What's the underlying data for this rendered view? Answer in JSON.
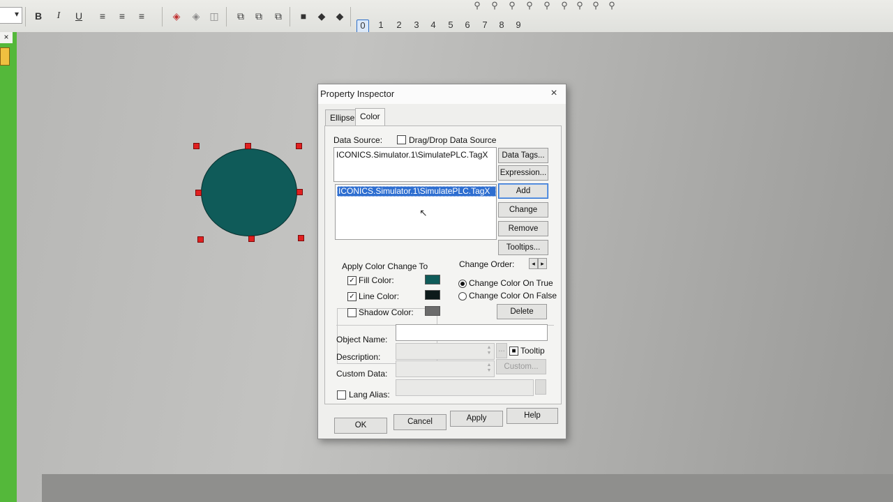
{
  "toolbar": {
    "format_buttons": {
      "bold": "B",
      "italic": "I",
      "underline": "U"
    },
    "level_buttons": [
      "0",
      "1",
      "2",
      "3",
      "4",
      "5",
      "6",
      "7",
      "8",
      "9"
    ],
    "selected_level": "0"
  },
  "left_panel": {
    "close_label": "×"
  },
  "dialog": {
    "title": "Property Inspector",
    "close_label": "×",
    "tabs": [
      {
        "label": "Ellipse",
        "selected": false
      },
      {
        "label": "Color",
        "selected": true
      }
    ],
    "data_source": {
      "label": "Data Source:",
      "drag_drop_label": "Drag/Drop Data Source",
      "drag_drop_checked": false,
      "expression_value": "ICONICS.Simulator.1\\SimulatePLC.TagX",
      "list_items": [
        {
          "text": "ICONICS.Simulator.1\\SimulatePLC.TagX",
          "selected": true
        }
      ]
    },
    "side_buttons": {
      "data_tags": "Data Tags...",
      "expression": "Expression...",
      "add": "Add",
      "change": "Change",
      "remove": "Remove",
      "tooltips": "Tooltips..."
    },
    "apply_color_change": {
      "group_label": "Apply Color Change To",
      "items": [
        {
          "label": "Fill Color:",
          "checked": true,
          "color": "#0f5b59"
        },
        {
          "label": "Line Color:",
          "checked": true,
          "color": "#0d1a1a"
        },
        {
          "label": "Shadow Color:",
          "checked": false,
          "color": "#6b6b6b"
        }
      ]
    },
    "change_order": {
      "label": "Change Order:",
      "left_arrow": "◂",
      "right_arrow": "▸",
      "options": [
        {
          "label": "Change Color On True",
          "selected": true
        },
        {
          "label": "Change Color On False",
          "selected": false
        }
      ],
      "delete_label": "Delete"
    },
    "object_name": {
      "label": "Object Name:",
      "value": ""
    },
    "description": {
      "label": "Description:",
      "value": "",
      "browse_label": "..."
    },
    "tooltip": {
      "label": "Tooltip",
      "checked": true
    },
    "custom_data": {
      "label": "Custom Data:",
      "value": "",
      "button_label": "Custom..."
    },
    "lang_alias": {
      "label": "Lang Alias:",
      "checked": false,
      "value": ""
    },
    "footer_buttons": {
      "ok": "OK",
      "cancel": "Cancel",
      "apply": "Apply",
      "help": "Help"
    }
  },
  "colors": {
    "ellipse_fill": "#0f5b59",
    "selection_handle": "#e02020",
    "list_selection": "#2e6ed0",
    "side_strip": "#54b83a"
  },
  "icons": [
    "chevron-down-icon",
    "align-left-icon",
    "align-center-icon",
    "align-right-icon",
    "group-icon",
    "ungroup-icon",
    "layer-icon",
    "zoom-icon",
    "mouse-cursor-icon"
  ]
}
